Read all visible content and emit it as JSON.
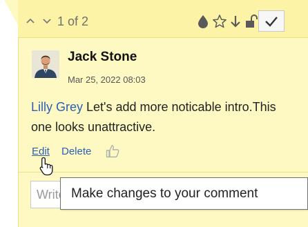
{
  "header": {
    "counter": "1 of 2",
    "icons": [
      "chevron-up-icon",
      "chevron-down-icon",
      "drop-icon",
      "star-icon",
      "arrow-down-icon",
      "lock-icon",
      "check-icon"
    ]
  },
  "comment": {
    "author": "Jack Stone",
    "timestamp": "Mar 25, 2022 08:03",
    "mention": "Lilly Grey",
    "text": " Let's add more noticable intro.This one looks unattractive."
  },
  "actions": {
    "edit_label": "Edit",
    "delete_label": "Delete"
  },
  "reply": {
    "placeholder": "Write"
  },
  "tooltip": {
    "text": "Make changes to your comment"
  },
  "colors": {
    "panel_bg": "#fef9c3",
    "header_bg": "#fcf3a6",
    "link": "#2b5fb4",
    "border": "#eadf8a"
  }
}
